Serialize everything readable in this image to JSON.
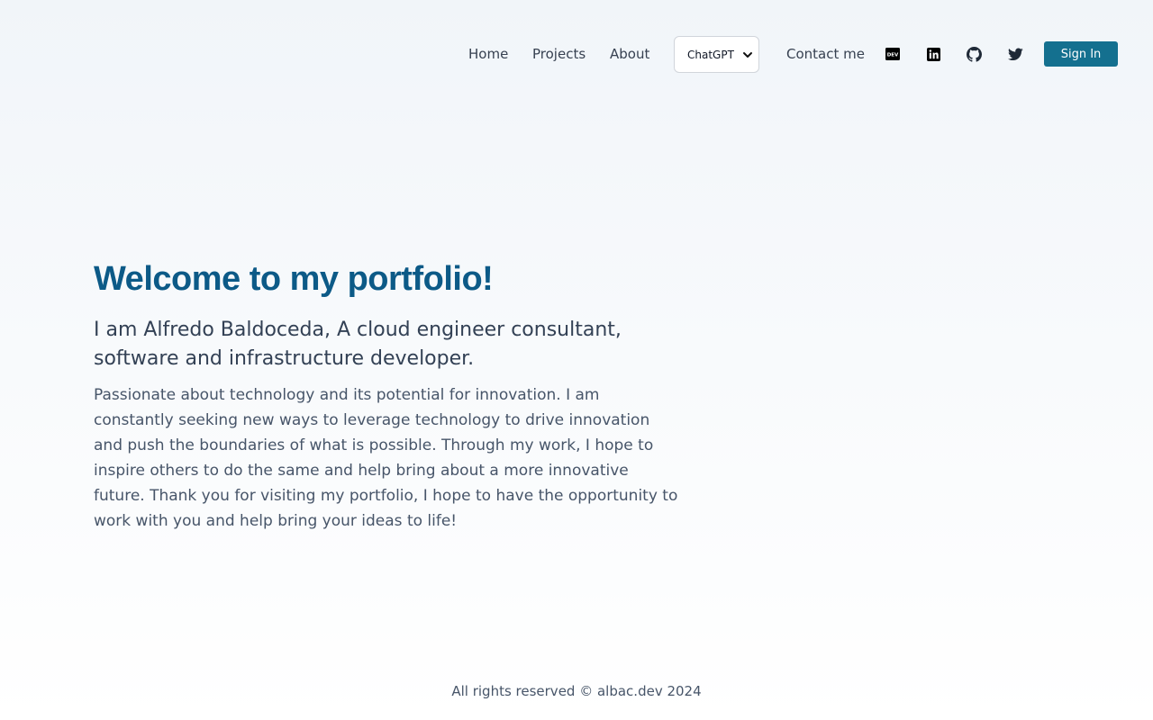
{
  "nav": {
    "links": [
      {
        "label": "Home"
      },
      {
        "label": "Projects"
      },
      {
        "label": "About"
      }
    ],
    "model_select": {
      "selected": "ChatGPT"
    },
    "contact_label": "Contact me",
    "social_icons": [
      "dev-icon",
      "linkedin-icon",
      "github-icon",
      "twitter-icon"
    ],
    "signin_label": "Sign In"
  },
  "hero": {
    "title": "Welcome to my portfolio!",
    "subtitle": "I am Alfredo Baldoceda, A cloud engineer consultant, software and infrastructure developer.",
    "body": "Passionate about technology and its potential for innovation. I am constantly seeking new ways to leverage technology to drive innovation and push the boundaries of what is possible. Through my work, I hope to inspire others to do the same and help bring about a more innovative future. Thank you for visiting my portfolio, I hope to have the opportunity to work with you and help bring your ideas to life!"
  },
  "footer": {
    "text": "All rights reserved © albac.dev 2024"
  },
  "colors": {
    "accent": "#0c5a87",
    "button": "#14708f",
    "text": "#334155"
  }
}
